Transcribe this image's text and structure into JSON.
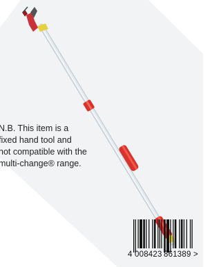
{
  "note": {
    "lines": [
      "N.B. This item is a",
      "fixed hand tool and",
      "not compatible with the",
      "multi-change® range."
    ]
  },
  "barcode": {
    "lead_digit": "4",
    "left_group": "008423",
    "right_group": "861389",
    "trailing_mark": ">"
  },
  "colors": {
    "pole": "#dfe6ea",
    "pole_shadow": "#b9c6cc",
    "grip_red": "#d9312b",
    "accent_yellow": "#e9d23a",
    "background_panel": "#eef1f2"
  }
}
